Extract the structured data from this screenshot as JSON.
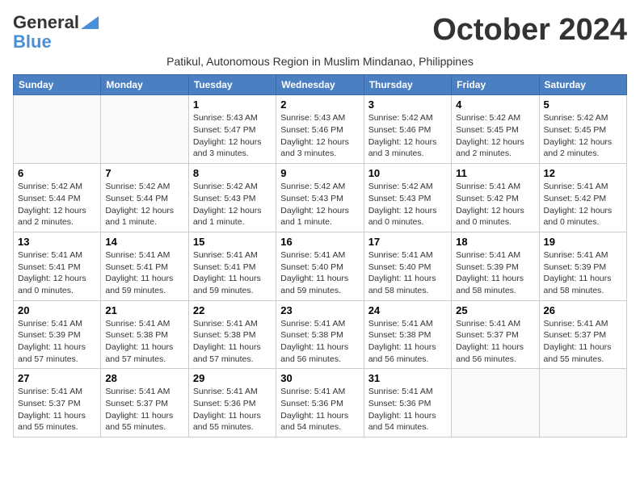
{
  "logo": {
    "line1": "General",
    "line2": "Blue"
  },
  "title": "October 2024",
  "subtitle": "Patikul, Autonomous Region in Muslim Mindanao, Philippines",
  "days_of_week": [
    "Sunday",
    "Monday",
    "Tuesday",
    "Wednesday",
    "Thursday",
    "Friday",
    "Saturday"
  ],
  "weeks": [
    [
      {
        "day": "",
        "info": ""
      },
      {
        "day": "",
        "info": ""
      },
      {
        "day": "1",
        "info": "Sunrise: 5:43 AM\nSunset: 5:47 PM\nDaylight: 12 hours and 3 minutes."
      },
      {
        "day": "2",
        "info": "Sunrise: 5:43 AM\nSunset: 5:46 PM\nDaylight: 12 hours and 3 minutes."
      },
      {
        "day": "3",
        "info": "Sunrise: 5:42 AM\nSunset: 5:46 PM\nDaylight: 12 hours and 3 minutes."
      },
      {
        "day": "4",
        "info": "Sunrise: 5:42 AM\nSunset: 5:45 PM\nDaylight: 12 hours and 2 minutes."
      },
      {
        "day": "5",
        "info": "Sunrise: 5:42 AM\nSunset: 5:45 PM\nDaylight: 12 hours and 2 minutes."
      }
    ],
    [
      {
        "day": "6",
        "info": "Sunrise: 5:42 AM\nSunset: 5:44 PM\nDaylight: 12 hours and 2 minutes."
      },
      {
        "day": "7",
        "info": "Sunrise: 5:42 AM\nSunset: 5:44 PM\nDaylight: 12 hours and 1 minute."
      },
      {
        "day": "8",
        "info": "Sunrise: 5:42 AM\nSunset: 5:43 PM\nDaylight: 12 hours and 1 minute."
      },
      {
        "day": "9",
        "info": "Sunrise: 5:42 AM\nSunset: 5:43 PM\nDaylight: 12 hours and 1 minute."
      },
      {
        "day": "10",
        "info": "Sunrise: 5:42 AM\nSunset: 5:43 PM\nDaylight: 12 hours and 0 minutes."
      },
      {
        "day": "11",
        "info": "Sunrise: 5:41 AM\nSunset: 5:42 PM\nDaylight: 12 hours and 0 minutes."
      },
      {
        "day": "12",
        "info": "Sunrise: 5:41 AM\nSunset: 5:42 PM\nDaylight: 12 hours and 0 minutes."
      }
    ],
    [
      {
        "day": "13",
        "info": "Sunrise: 5:41 AM\nSunset: 5:41 PM\nDaylight: 12 hours and 0 minutes."
      },
      {
        "day": "14",
        "info": "Sunrise: 5:41 AM\nSunset: 5:41 PM\nDaylight: 11 hours and 59 minutes."
      },
      {
        "day": "15",
        "info": "Sunrise: 5:41 AM\nSunset: 5:41 PM\nDaylight: 11 hours and 59 minutes."
      },
      {
        "day": "16",
        "info": "Sunrise: 5:41 AM\nSunset: 5:40 PM\nDaylight: 11 hours and 59 minutes."
      },
      {
        "day": "17",
        "info": "Sunrise: 5:41 AM\nSunset: 5:40 PM\nDaylight: 11 hours and 58 minutes."
      },
      {
        "day": "18",
        "info": "Sunrise: 5:41 AM\nSunset: 5:39 PM\nDaylight: 11 hours and 58 minutes."
      },
      {
        "day": "19",
        "info": "Sunrise: 5:41 AM\nSunset: 5:39 PM\nDaylight: 11 hours and 58 minutes."
      }
    ],
    [
      {
        "day": "20",
        "info": "Sunrise: 5:41 AM\nSunset: 5:39 PM\nDaylight: 11 hours and 57 minutes."
      },
      {
        "day": "21",
        "info": "Sunrise: 5:41 AM\nSunset: 5:38 PM\nDaylight: 11 hours and 57 minutes."
      },
      {
        "day": "22",
        "info": "Sunrise: 5:41 AM\nSunset: 5:38 PM\nDaylight: 11 hours and 57 minutes."
      },
      {
        "day": "23",
        "info": "Sunrise: 5:41 AM\nSunset: 5:38 PM\nDaylight: 11 hours and 56 minutes."
      },
      {
        "day": "24",
        "info": "Sunrise: 5:41 AM\nSunset: 5:38 PM\nDaylight: 11 hours and 56 minutes."
      },
      {
        "day": "25",
        "info": "Sunrise: 5:41 AM\nSunset: 5:37 PM\nDaylight: 11 hours and 56 minutes."
      },
      {
        "day": "26",
        "info": "Sunrise: 5:41 AM\nSunset: 5:37 PM\nDaylight: 11 hours and 55 minutes."
      }
    ],
    [
      {
        "day": "27",
        "info": "Sunrise: 5:41 AM\nSunset: 5:37 PM\nDaylight: 11 hours and 55 minutes."
      },
      {
        "day": "28",
        "info": "Sunrise: 5:41 AM\nSunset: 5:37 PM\nDaylight: 11 hours and 55 minutes."
      },
      {
        "day": "29",
        "info": "Sunrise: 5:41 AM\nSunset: 5:36 PM\nDaylight: 11 hours and 55 minutes."
      },
      {
        "day": "30",
        "info": "Sunrise: 5:41 AM\nSunset: 5:36 PM\nDaylight: 11 hours and 54 minutes."
      },
      {
        "day": "31",
        "info": "Sunrise: 5:41 AM\nSunset: 5:36 PM\nDaylight: 11 hours and 54 minutes."
      },
      {
        "day": "",
        "info": ""
      },
      {
        "day": "",
        "info": ""
      }
    ]
  ]
}
